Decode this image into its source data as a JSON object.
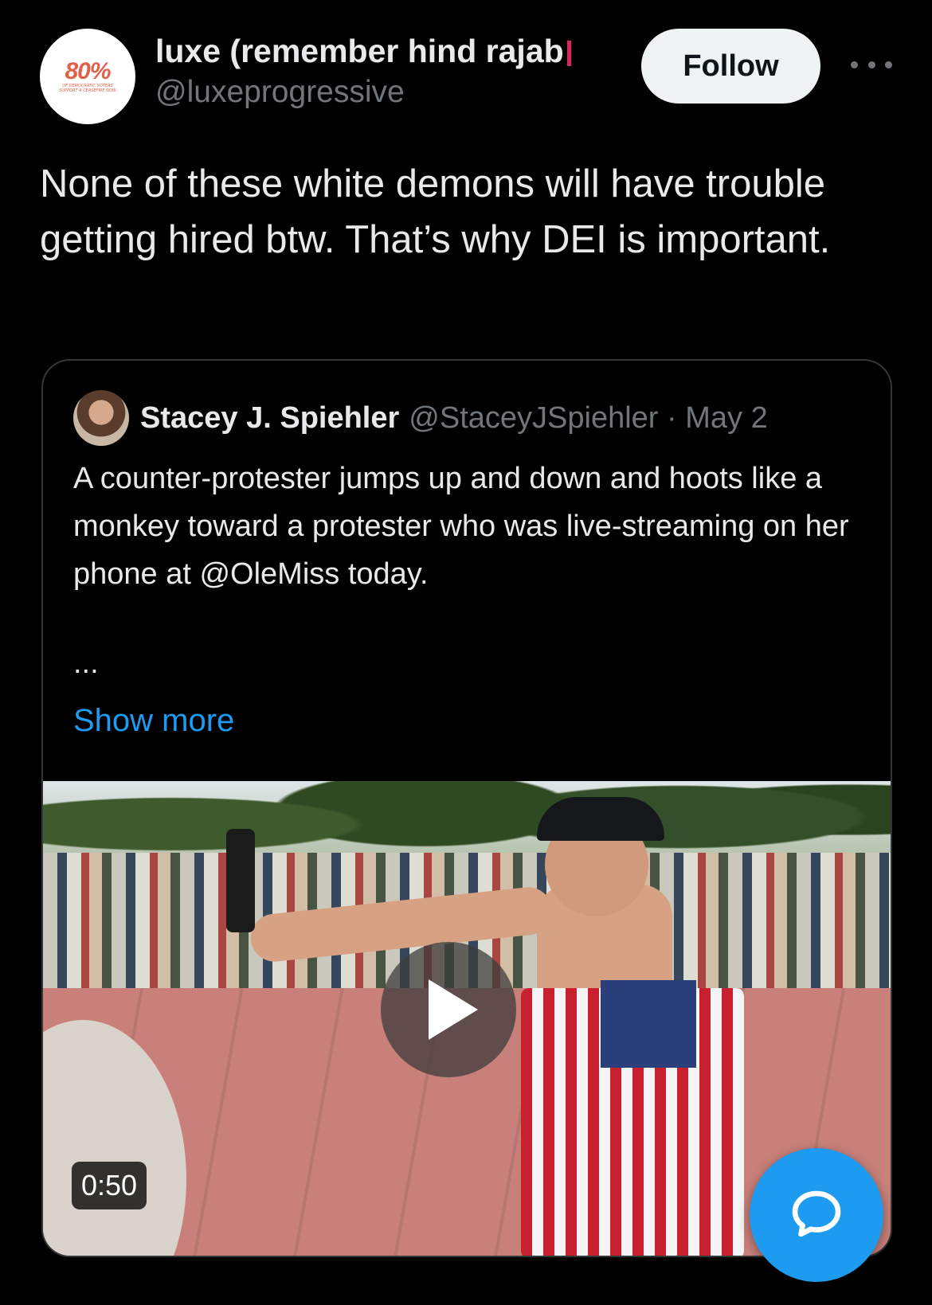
{
  "author": {
    "display_name": "luxe (remember hind rajab",
    "handle": "@luxeprogressive",
    "avatar": {
      "big_text": "80%",
      "small_line1": "OF DEMOCRATIC VOTERS",
      "small_line2": "SUPPORT A CEASEFIRE NOW"
    }
  },
  "follow_label": "Follow",
  "tweet": {
    "text": "None of these white demons will have trouble getting hired btw. That’s why DEI is important."
  },
  "quote": {
    "name": "Stacey J. Spiehler",
    "handle_date": "@StaceyJSpiehler · May 2",
    "text": "A counter-protester jumps up and down and hoots like a monkey toward a protester who was live-streaming on her phone at @OleMiss today.",
    "ellipsis": "...",
    "show_more": "Show more",
    "video_duration": "0:50"
  },
  "colors": {
    "background": "#000000",
    "accent": "#1d9bf0",
    "text": "#e7e9ea",
    "muted": "#71767b"
  },
  "icons": [
    "more-icon",
    "play-icon",
    "compose-reply-icon"
  ]
}
